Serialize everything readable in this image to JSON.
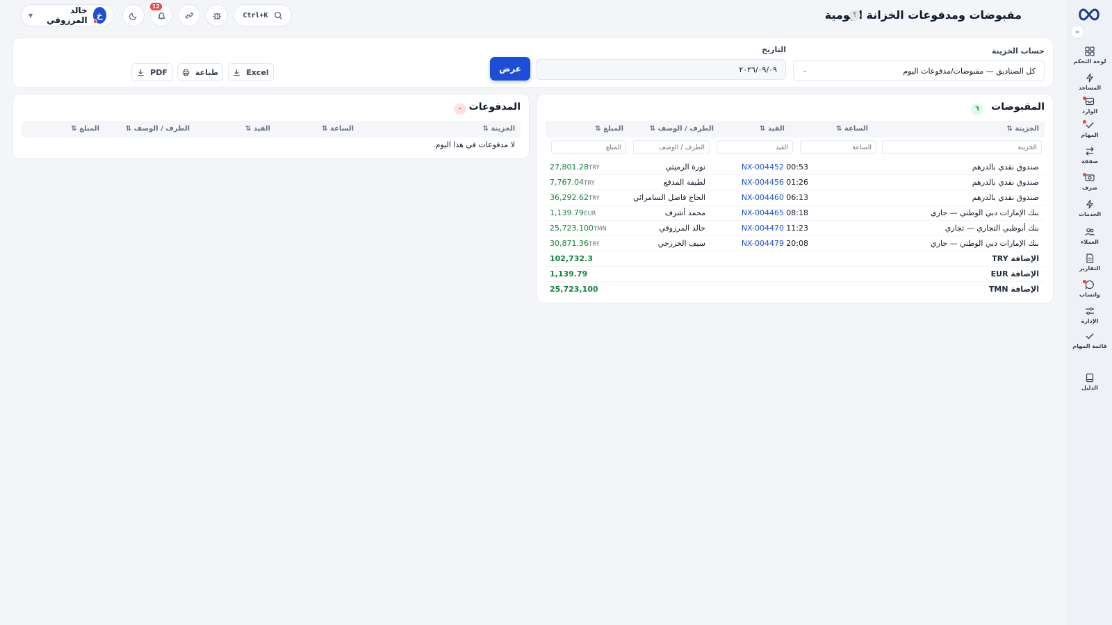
{
  "header": {
    "title": "مقبوضات ومدفوعات الخزانة اليومية",
    "help": "؟",
    "search_shortcut": "Ctrl+K",
    "notifications_count": "12",
    "user_name": "خالد المرزوقي",
    "user_initial": "خ"
  },
  "sidebar": {
    "items": [
      {
        "label": "لوحة التحكم",
        "icon": "dashboard-icon"
      },
      {
        "label": "المساعد",
        "icon": "bolt-icon"
      },
      {
        "label": "الوارد",
        "icon": "inbox-icon"
      },
      {
        "label": "المهام",
        "icon": "check-icon"
      },
      {
        "label": "صفقة",
        "icon": "swap-icon"
      },
      {
        "label": "صرف",
        "icon": "cash-icon"
      },
      {
        "label": "الخدمات",
        "icon": "bolt-icon"
      },
      {
        "label": "العملاء",
        "icon": "users-icon"
      },
      {
        "label": "التقارير",
        "icon": "report-icon"
      },
      {
        "label": "واتساب",
        "icon": "chat-icon"
      },
      {
        "label": "الإدارة",
        "icon": "sliders-icon"
      },
      {
        "label": "قائمة المهام",
        "icon": "check-icon"
      },
      {
        "label": "الدليل",
        "icon": "book-icon"
      }
    ]
  },
  "filters": {
    "account_label": "حساب الخزينة",
    "account_value": "كل الصناديق — مقبوضات/مدفوعات اليوم",
    "date_label": "التاريخ",
    "date_value": "٢٠٢٦/٠٩/٠٩",
    "show_label": "عرض",
    "excel_label": "Excel",
    "print_label": "طباعة",
    "pdf_label": "PDF"
  },
  "receipts": {
    "title": "المقبوضات",
    "count": "٦",
    "columns": [
      "الخزينة ⇅",
      "الساعة ⇅",
      "القيد ⇅",
      "الطرف / الوصف ⇅",
      "المبلغ ⇅"
    ],
    "filter_placeholders": [
      "الخزينة",
      "الساعة",
      "القيد",
      "الطرف / الوصف",
      "المبلغ"
    ],
    "rows": [
      {
        "treasury": "صندوق نقدي بالدرهم",
        "time": "00:53",
        "ref": "NX-004452",
        "party": "نورة الرميثي",
        "amount": "27,801.28",
        "currency": "TRY"
      },
      {
        "treasury": "صندوق نقدي بالدرهم",
        "time": "01:26",
        "ref": "NX-004456",
        "party": "لطيفة المدفع",
        "amount": "7,767.04",
        "currency": "TRY"
      },
      {
        "treasury": "صندوق نقدي بالدرهم",
        "time": "06:13",
        "ref": "NX-004460",
        "party": "الحاج فاضل السامرائي",
        "amount": "36,292.62",
        "currency": "TRY"
      },
      {
        "treasury": "بنك الإمارات دبي الوطني — جاري",
        "time": "08:18",
        "ref": "NX-004465",
        "party": "محمد أشرف",
        "amount": "1,139.79",
        "currency": "EUR"
      },
      {
        "treasury": "بنك أبوظبي التجاري — تجاري",
        "time": "11:23",
        "ref": "NX-004470",
        "party": "خالد المرزوقي",
        "amount": "25,723,100",
        "currency": "TMN"
      },
      {
        "treasury": "بنك الإمارات دبي الوطني — جاري",
        "time": "20:08",
        "ref": "NX-004479",
        "party": "سيف الخزرجي",
        "amount": "30,871.36",
        "currency": "TRY"
      }
    ],
    "totals": [
      {
        "label": "الإضافة TRY",
        "amount": "102,732.3"
      },
      {
        "label": "الإضافة EUR",
        "amount": "1,139.79"
      },
      {
        "label": "الإضافة TMN",
        "amount": "25,723,100"
      }
    ]
  },
  "payments": {
    "title": "المدفوعات",
    "count": "٠",
    "columns": [
      "الخزينة ⇅",
      "الساعة ⇅",
      "القيد ⇅",
      "الطرف / الوصف ⇅",
      "المبلغ ⇅"
    ],
    "empty_message": "لا مدفوعات في هذا اليوم."
  },
  "colors": {
    "primary": "#1d4ed8",
    "positive": "#15803d",
    "danger": "#ef4444"
  }
}
